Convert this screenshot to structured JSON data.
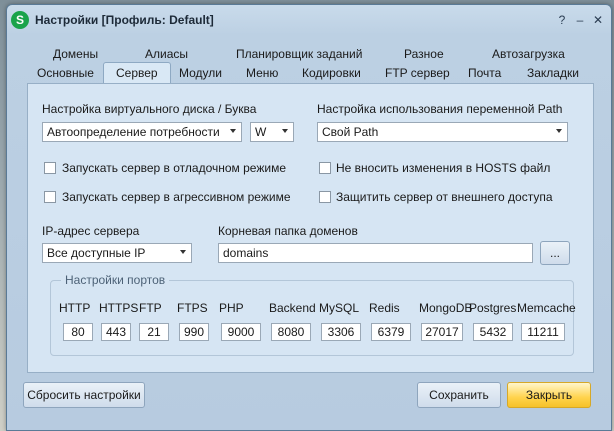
{
  "window": {
    "title": "Настройки [Профиль: Default]",
    "app_icon_letter": "S"
  },
  "tabs_row1": [
    "Домены",
    "Алиасы",
    "Планировщик заданий",
    "Разное",
    "Автозагрузка"
  ],
  "tabs_row2": [
    "Основные",
    "Сервер",
    "Модули",
    "Меню",
    "Кодировки",
    "FTP сервер",
    "Почта",
    "Закладки"
  ],
  "active_tab": "Сервер",
  "server": {
    "vdisk_label": "Настройка виртуального диска / Буква",
    "vdisk_value": "Автоопределение потребности",
    "drive_letter": "W",
    "path_label": "Настройка использования переменной Path",
    "path_value": "Свой Path",
    "checkboxes": {
      "debug": "Запускать сервер в отладочном режиме",
      "aggressive": "Запускать сервер в агрессивном режиме",
      "hosts": "Не вносить изменения в HOSTS файл",
      "protect": "Защитить сервер от внешнего доступа"
    },
    "ip_label": "IP-адрес сервера",
    "ip_value": "Все доступные IP",
    "root_label": "Корневая папка доменов",
    "root_value": "domains",
    "browse_label": "...",
    "ports_title": "Настройки портов",
    "ports": [
      {
        "name": "HTTP",
        "value": "80"
      },
      {
        "name": "HTTPS",
        "value": "443"
      },
      {
        "name": "FTP",
        "value": "21"
      },
      {
        "name": "FTPS",
        "value": "990"
      },
      {
        "name": "PHP",
        "value": "9000"
      },
      {
        "name": "Backend",
        "value": "8080"
      },
      {
        "name": "MySQL",
        "value": "3306"
      },
      {
        "name": "Redis",
        "value": "6379"
      },
      {
        "name": "MongoDB",
        "value": "27017"
      },
      {
        "name": "Postgres",
        "value": "5432"
      },
      {
        "name": "Memcache",
        "value": "11211"
      }
    ]
  },
  "footer": {
    "reset": "Сбросить настройки",
    "save": "Сохранить",
    "close": "Закрыть"
  },
  "colors": {
    "accent_close": "#f6c22a",
    "app_icon": "#1aa34a"
  }
}
